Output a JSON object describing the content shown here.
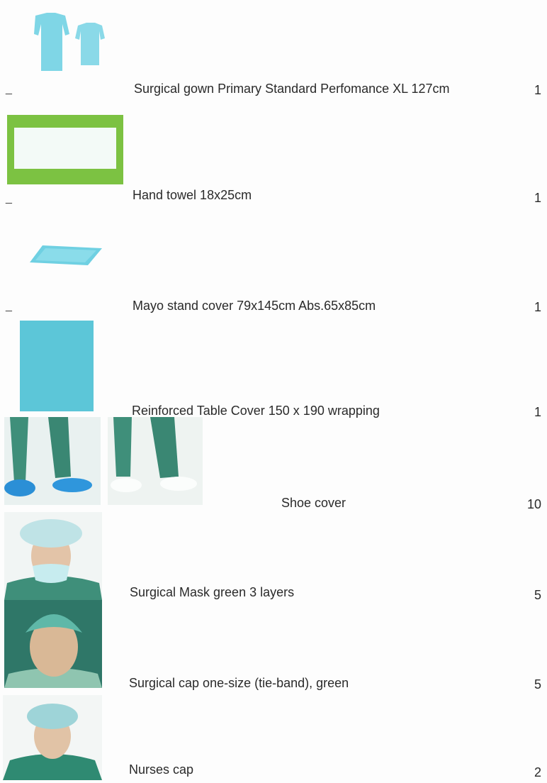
{
  "items": [
    {
      "name": "Surgical gown Primary Standard Perfomance XL 127cm",
      "qty": "1",
      "marker": "_"
    },
    {
      "name": "Hand towel 18x25cm",
      "qty": "1",
      "marker": "_"
    },
    {
      "name": "Mayo stand cover 79x145cm Abs.65x85cm",
      "qty": "1",
      "marker": "_"
    },
    {
      "name": "Reinforced Table Cover 150 x 190 wrapping",
      "qty": "1"
    },
    {
      "name": "Shoe cover",
      "qty": "10"
    },
    {
      "name": "Surgical Mask green 3 layers",
      "qty": "5"
    },
    {
      "name": "Surgical cap one-size (tie-band), green",
      "qty": "5"
    },
    {
      "name": "Nurses cap",
      "qty": "2"
    }
  ],
  "colors": {
    "gown": "#7fd6e6",
    "towel_frame": "#7cc242",
    "drape_blue": "#5cc6d8",
    "scrubs_green": "#3f8f7a",
    "shoe_cover_blue": "#2b8fd6"
  }
}
